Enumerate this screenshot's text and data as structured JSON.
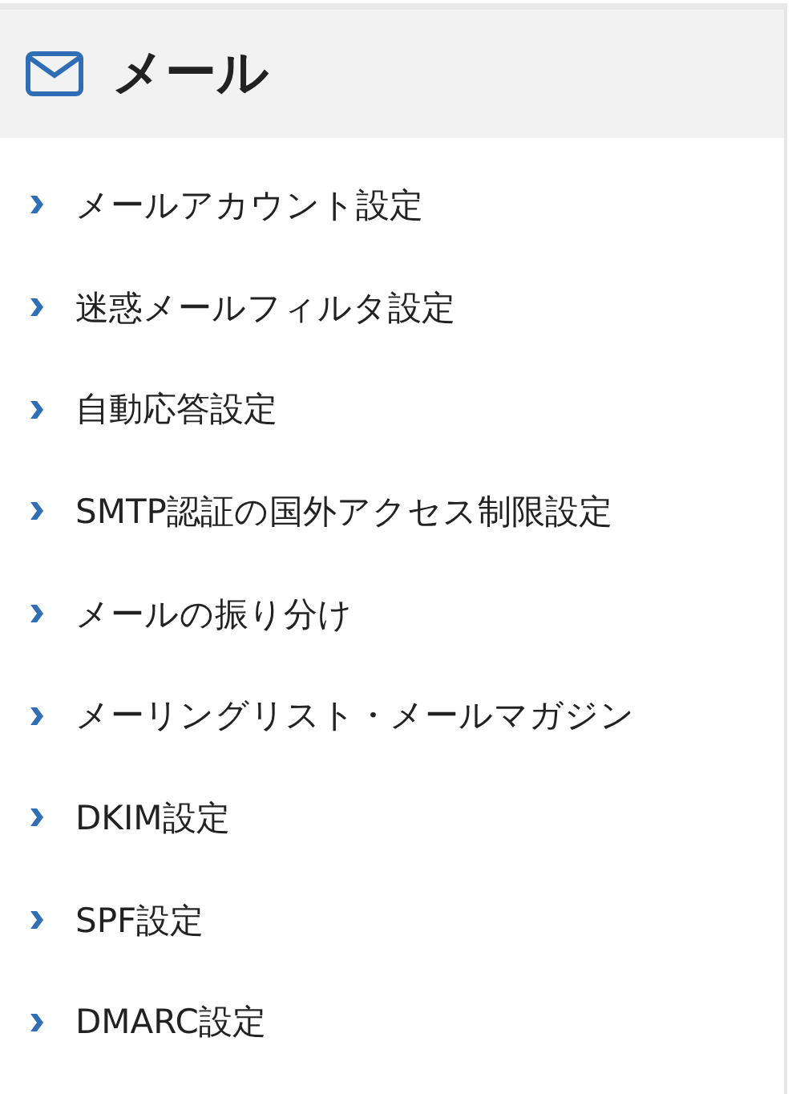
{
  "header": {
    "title": "メール"
  },
  "items": [
    {
      "label": "メールアカウント設定"
    },
    {
      "label": "迷惑メールフィルタ設定"
    },
    {
      "label": "自動応答設定"
    },
    {
      "label": "SMTP認証の国外アクセス制限設定"
    },
    {
      "label": "メールの振り分け"
    },
    {
      "label": "メーリングリスト・メールマガジン"
    },
    {
      "label": "DKIM設定"
    },
    {
      "label": "SPF設定"
    },
    {
      "label": "DMARC設定"
    }
  ]
}
